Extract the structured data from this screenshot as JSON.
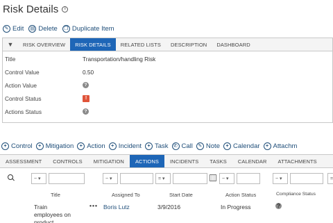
{
  "page": {
    "title": "Risk Details"
  },
  "actions": [
    {
      "label": "Edit",
      "icon": "pencil-icon",
      "glyph": "✎"
    },
    {
      "label": "Delete",
      "icon": "trash-icon",
      "glyph": "▤"
    },
    {
      "label": "Duplicate Item",
      "icon": "copy-icon",
      "glyph": "❐"
    }
  ],
  "detail_tabs": [
    "RISK OVERVIEW",
    "RISK DETAILS",
    "RELATED LISTS",
    "DESCRIPTION",
    "DASHBOARD"
  ],
  "detail_active_tab": "RISK DETAILS",
  "fields": [
    {
      "label": "Title",
      "value": "Transportation/handling Risk"
    },
    {
      "label": "Control Value",
      "value": "0.50"
    },
    {
      "label": "Action Value",
      "icon": "question-icon"
    },
    {
      "label": "Control Status",
      "icon": "warning-icon"
    },
    {
      "label": "Actions Status",
      "icon": "question-icon"
    }
  ],
  "add_items": [
    "Control",
    "Mitigation",
    "Action",
    "Incident",
    "Task",
    "Call",
    "Note",
    "Calendar",
    "Attachm"
  ],
  "related_tabs": [
    "ASSESSMENT",
    "CONTROLS",
    "MITIGATION",
    "ACTIONS",
    "INCIDENTS",
    "TASKS",
    "CALENDAR",
    "ATTACHMENTS"
  ],
  "related_active_tab": "ACTIONS",
  "filters": {
    "op1": "~ ▾",
    "op2": "~ ▾",
    "op3": "= ▾",
    "op4": "~ ▾",
    "op5": "~ ▾",
    "op6": "="
  },
  "table": {
    "headers": [
      "Title",
      "Assigned To",
      "Start Date",
      "Action Status",
      "Compliance Status"
    ],
    "row": {
      "title": "Train employees on product",
      "menu": "•••",
      "assigned_to": "Boris Lutz",
      "start_date": "3/9/2016",
      "action_status": "In Progress",
      "compliance_status": "?"
    }
  },
  "colors": {
    "accent": "#1e66b7",
    "link": "#1f4e79",
    "warning": "#e0543a"
  }
}
